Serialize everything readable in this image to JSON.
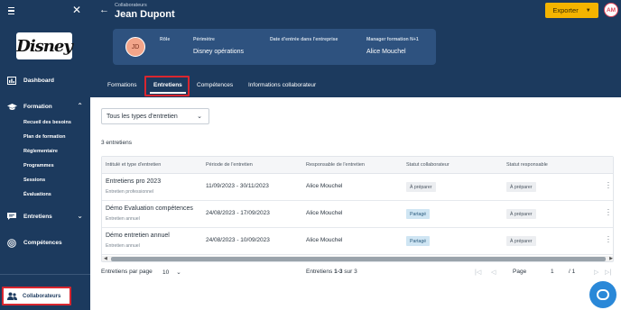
{
  "sidebar": {
    "logo_text": "Disney",
    "items": [
      {
        "label": "Dashboard",
        "icon": "dashboard-icon"
      },
      {
        "label": "Formation",
        "icon": "graduation-cap-icon",
        "expanded": true
      },
      {
        "label": "Entretiens",
        "icon": "chat-icon",
        "expanded": false
      },
      {
        "label": "Compétences",
        "icon": "target-icon"
      },
      {
        "label": "Collaborateurs",
        "icon": "users-icon",
        "active": true
      }
    ],
    "formation_subitems": [
      "Recueil des besoins",
      "Plan de formation",
      "Réglementaire",
      "Programmes",
      "Sessions",
      "Évaluations"
    ]
  },
  "header": {
    "breadcrumb": "Collaborateurs",
    "name": "Jean Dupont",
    "export_label": "Exporter",
    "user_initials": "AM"
  },
  "profile": {
    "initials": "JD",
    "role_label": "Rôle",
    "role_value": "",
    "perimetre_label": "Périmètre",
    "perimetre_value": "Disney opérations",
    "entree_label": "Date d'entrée dans l'entreprise",
    "entree_value": "",
    "manager_label": "Manager formation N+1",
    "manager_value": "Alice Mouchel"
  },
  "tabs": [
    "Formations",
    "Entretiens",
    "Compétences",
    "Informations collaborateur"
  ],
  "filter": {
    "value": "Tous les types d'entretien"
  },
  "count_text": "3 entretiens",
  "table": {
    "columns": [
      "Intitulé et type d'entretien",
      "Période de l'entretien",
      "Responsable de l'entretien",
      "Statut collaborateur",
      "Statut responsable"
    ],
    "rows": [
      {
        "title": "Entretiens pro 2023",
        "type": "Entretien professionnel",
        "period": "11/09/2023 - 30/11/2023",
        "responsable": "Alice Mouchel",
        "statut_collab": "À préparer",
        "statut_resp": "À préparer"
      },
      {
        "title": "Démo Evaluation compétences",
        "type": "Entretien annuel",
        "period": "24/08/2023 - 17/09/2023",
        "responsable": "Alice Mouchel",
        "statut_collab": "Partagé",
        "statut_resp": "À préparer"
      },
      {
        "title": "Démo entretien annuel",
        "type": "Entretien annuel",
        "period": "24/08/2023 - 10/09/2023",
        "responsable": "Alice Mouchel",
        "statut_collab": "Partagé",
        "statut_resp": "À préparer"
      }
    ]
  },
  "pagination": {
    "per_page_label": "Entretiens par page",
    "per_page_value": "10",
    "range_prefix": "Entretiens ",
    "range": "1-3",
    "range_suffix": " sur 3",
    "page_label": "Page",
    "page_value": "1",
    "page_total": "/ 1"
  },
  "colors": {
    "sidebar": "#1c3a5e",
    "accent": "#f4b400",
    "highlight": "#d9262f",
    "help": "#2a88d8"
  }
}
